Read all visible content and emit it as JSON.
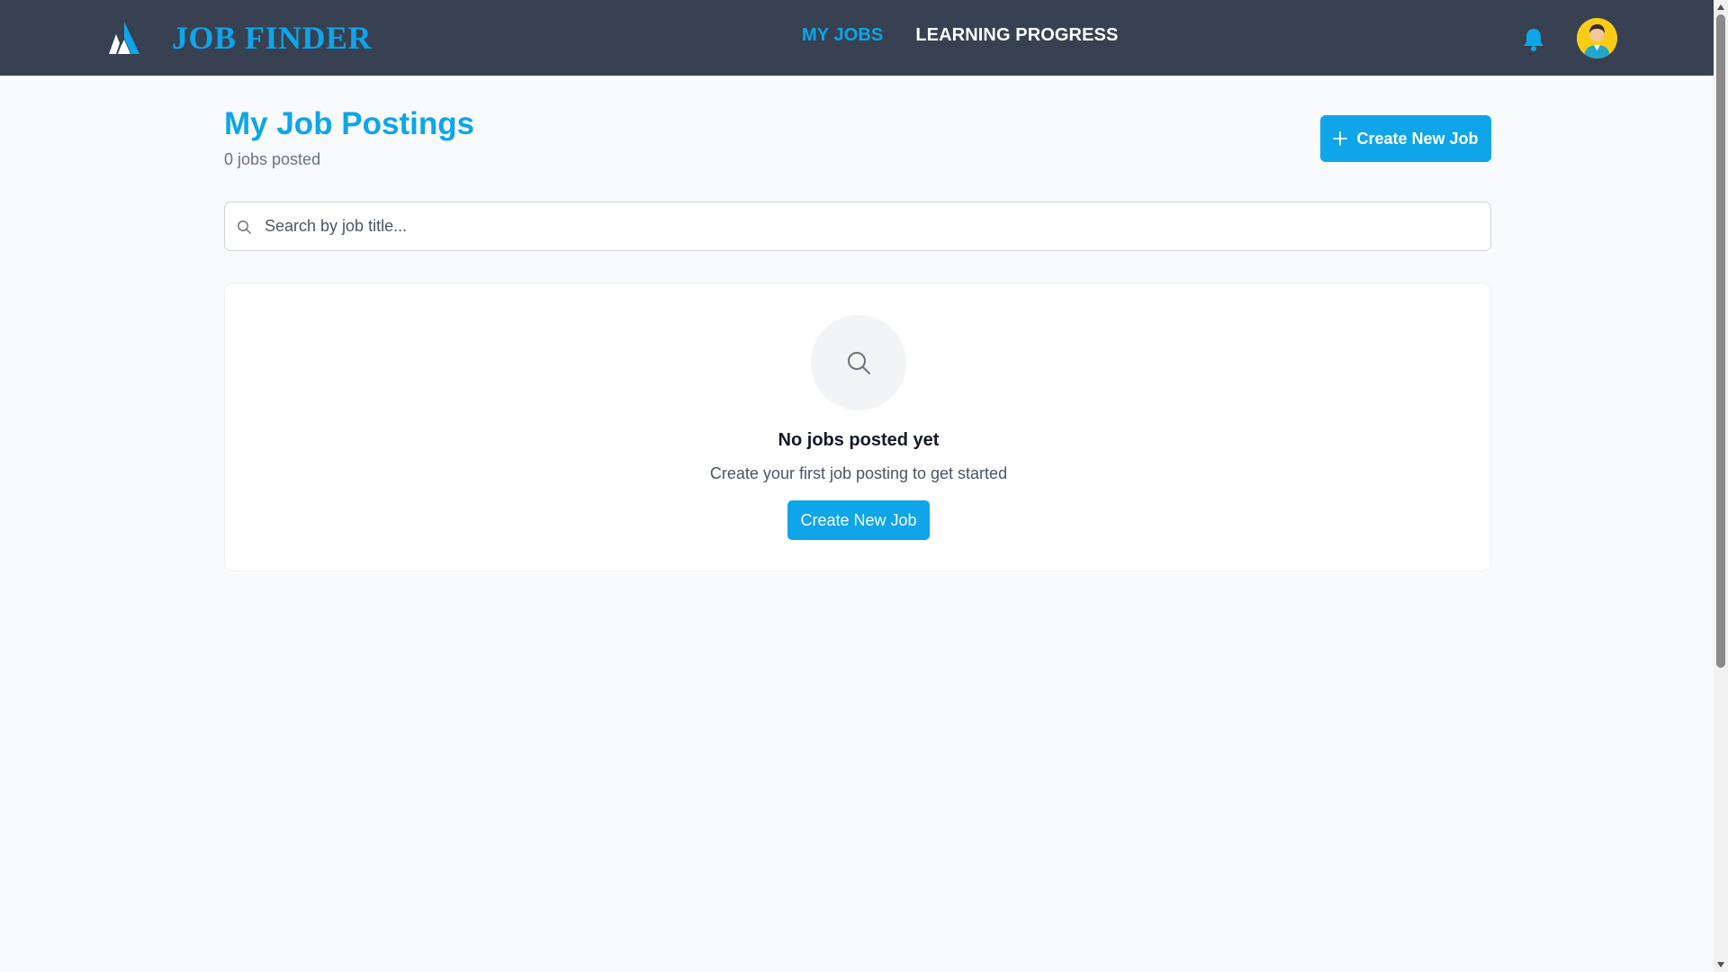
{
  "header": {
    "brand_name": "JOB FINDER",
    "nav": [
      {
        "label": "MY JOBS",
        "active": true
      },
      {
        "label": "LEARNING PROGRESS",
        "active": false
      }
    ],
    "icons": {
      "logo": "triangle-logo-icon",
      "notifications": "bell-icon",
      "profile": "user-avatar-icon"
    }
  },
  "main": {
    "title": "My Job Postings",
    "subtitle": "0 jobs posted",
    "create_button_label": "Create New Job",
    "search": {
      "placeholder": "Search by job title...",
      "value": ""
    },
    "empty_state": {
      "title": "No jobs posted yet",
      "description": "Create your first job posting to get started",
      "button_label": "Create New Job"
    }
  },
  "colors": {
    "accent": "#0ea5e9",
    "header_bg": "#374151",
    "page_bg": "#f8fafc",
    "avatar_bg": "#facc15"
  }
}
